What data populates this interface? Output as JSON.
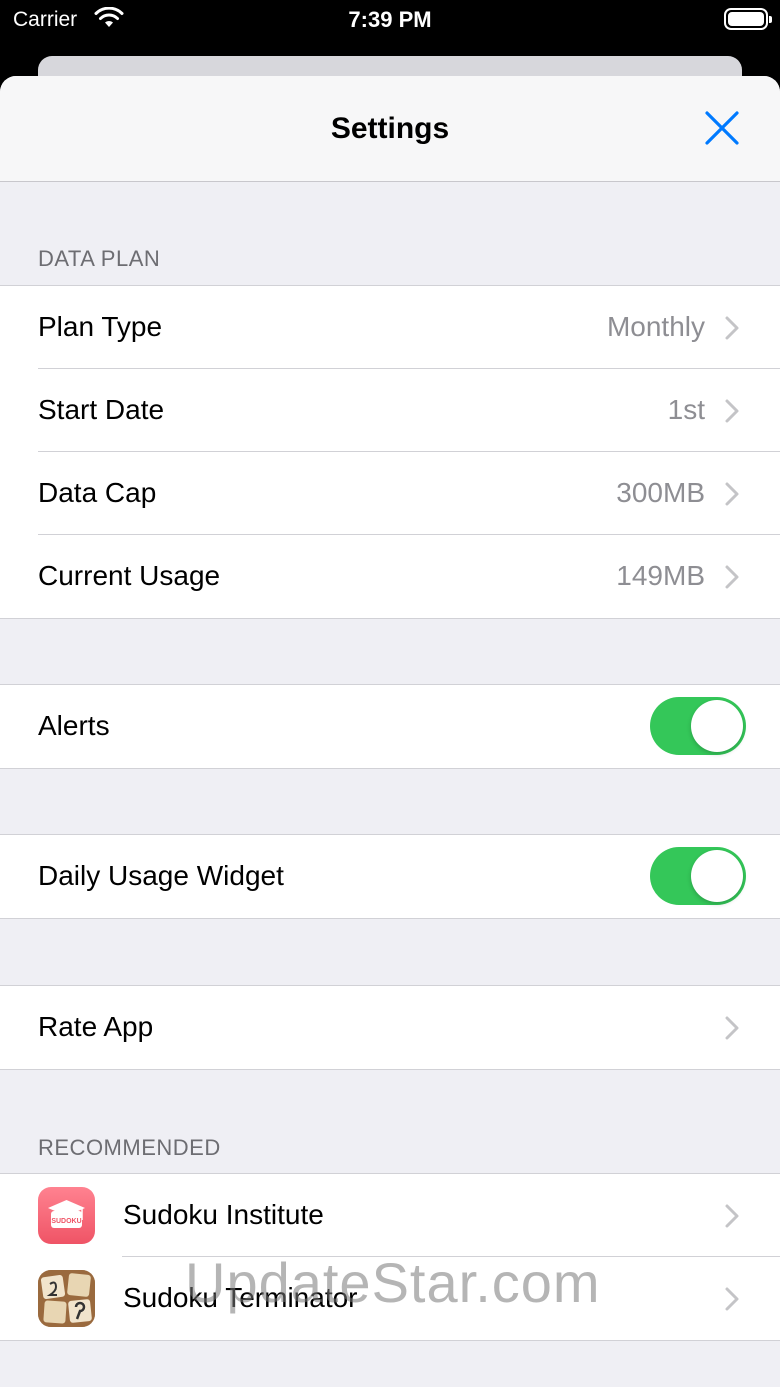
{
  "status_bar": {
    "carrier": "Carrier",
    "time": "7:39 PM"
  },
  "nav": {
    "title": "Settings"
  },
  "data_plan": {
    "header": "DATA PLAN",
    "rows": [
      {
        "label": "Plan Type",
        "value": "Monthly"
      },
      {
        "label": "Start Date",
        "value": "1st"
      },
      {
        "label": "Data Cap",
        "value": "300MB"
      },
      {
        "label": "Current Usage",
        "value": "149MB"
      }
    ]
  },
  "alerts": {
    "label": "Alerts",
    "enabled": true
  },
  "widget": {
    "label": "Daily Usage Widget",
    "enabled": true
  },
  "rate": {
    "label": "Rate App"
  },
  "recommended": {
    "header": "RECOMMENDED",
    "apps": [
      {
        "name": "Sudoku Institute",
        "icon_label": "SUDOKU"
      },
      {
        "name": "Sudoku Terminator"
      }
    ]
  },
  "watermark": "UpdateStar.com",
  "colors": {
    "accent": "#007aff",
    "toggle_on": "#34c759",
    "background": "#efeff4"
  }
}
